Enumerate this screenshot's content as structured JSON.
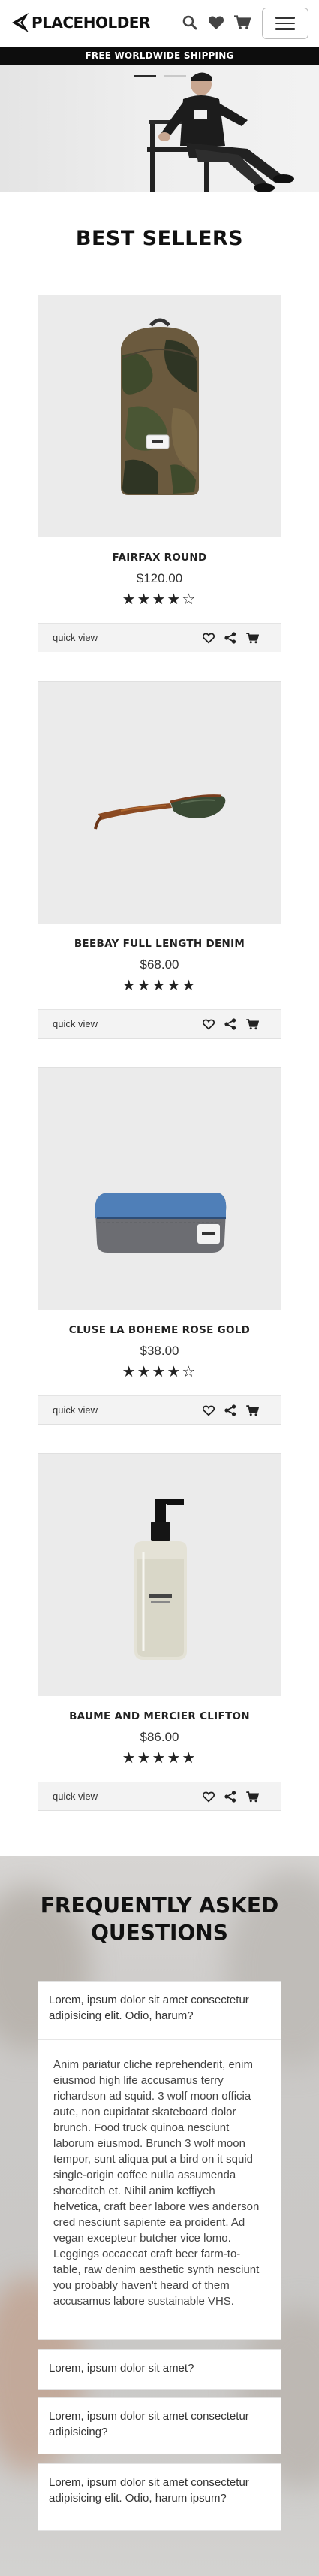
{
  "header": {
    "logo_text": "PLACEHOLDER",
    "icons": [
      "search-icon",
      "heart-icon",
      "cart-icon",
      "menu-icon"
    ]
  },
  "promo": {
    "text": "FREE WORLDWIDE SHIPPING"
  },
  "hero": {
    "slides": 2,
    "active_slide": 1
  },
  "best_sellers": {
    "title": "BEST SELLERS",
    "quick_view_label": "quick view",
    "products": [
      {
        "name": "FAIRFAX ROUND",
        "price": "$120.00",
        "rating": 4,
        "stars": "★★★★☆"
      },
      {
        "name": "BEEBAY FULL LENGTH DENIM",
        "price": "$68.00",
        "rating": 5,
        "stars": "★★★★★"
      },
      {
        "name": "CLUSE LA BOHEME ROSE GOLD",
        "price": "$38.00",
        "rating": 4,
        "stars": "★★★★☆"
      },
      {
        "name": "BAUME AND MERCIER CLIFTON",
        "price": "$86.00",
        "rating": 5,
        "stars": "★★★★★"
      }
    ],
    "product_images": [
      "camo-backpack",
      "sunglasses",
      "pencil-case",
      "soap-bottle"
    ]
  },
  "faq": {
    "title_line1": "FREQUENTLY ASKED",
    "title_line2": "QUESTIONS",
    "items": [
      {
        "question": "Lorem, ipsum dolor sit amet consectetur adipisicing elit. Odio, harum?",
        "expanded": true,
        "answer": "Anim pariatur cliche reprehenderit, enim eiusmod high life accusamus terry richardson ad squid. 3 wolf moon officia aute, non cupidatat skateboard dolor brunch. Food truck quinoa nesciunt laborum eiusmod. Brunch 3 wolf moon tempor, sunt aliqua put a bird on it squid single-origin coffee nulla assumenda shoreditch et. Nihil anim keffiyeh helvetica, craft beer labore wes anderson cred nesciunt sapiente ea proident. Ad vegan excepteur butcher vice lomo. Leggings occaecat craft beer farm-to-table, raw denim aesthetic synth nesciunt you probably haven't heard of them accusamus labore sustainable VHS."
      },
      {
        "question": "Lorem, ipsum dolor sit amet?",
        "expanded": false
      },
      {
        "question": "Lorem, ipsum dolor sit amet consectetur adipisicing?",
        "expanded": false
      },
      {
        "question": "Lorem, ipsum dolor sit amet consectetur adipisicing elit. Odio, harum ipsum?",
        "expanded": false
      }
    ]
  }
}
